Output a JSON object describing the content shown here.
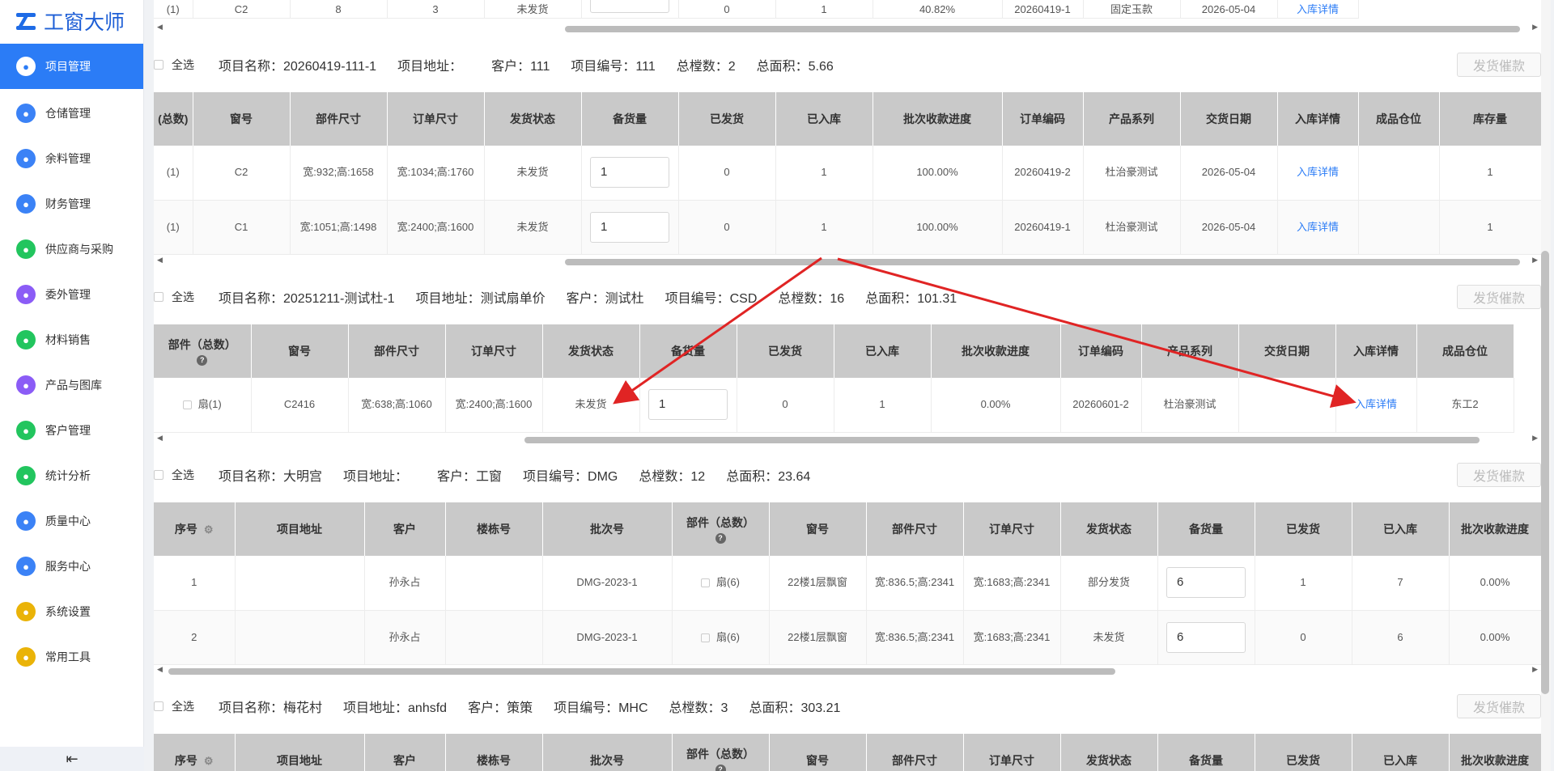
{
  "app": {
    "title": "工窗大师"
  },
  "sidebar": {
    "items": [
      {
        "label": "项目管理",
        "icon": "puzzle-icon",
        "color": "#22c55e",
        "active": true
      },
      {
        "label": "仓储管理",
        "icon": "layers-icon",
        "color": "#3b82f6"
      },
      {
        "label": "余料管理",
        "icon": "recycle-icon",
        "color": "#3b82f6"
      },
      {
        "label": "财务管理",
        "icon": "finance-icon",
        "color": "#3b82f6"
      },
      {
        "label": "供应商与采购",
        "icon": "supplier-icon",
        "color": "#22c55e"
      },
      {
        "label": "委外管理",
        "icon": "outsource-icon",
        "color": "#8b5cf6"
      },
      {
        "label": "材料销售",
        "icon": "material-sales-icon",
        "color": "#22c55e"
      },
      {
        "label": "产品与图库",
        "icon": "product-gallery-icon",
        "color": "#8b5cf6"
      },
      {
        "label": "客户管理",
        "icon": "customer-icon",
        "color": "#22c55e"
      },
      {
        "label": "统计分析",
        "icon": "stats-icon",
        "color": "#22c55e"
      },
      {
        "label": "质量中心",
        "icon": "flask-icon",
        "color": "#3b82f6"
      },
      {
        "label": "服务中心",
        "icon": "phone-icon",
        "color": "#3b82f6"
      },
      {
        "label": "系统设置",
        "icon": "settings-icon",
        "color": "#eab308"
      },
      {
        "label": "常用工具",
        "icon": "tools-icon",
        "color": "#eab308"
      }
    ],
    "collapse_icon": "collapse-menu-icon"
  },
  "common": {
    "select_all": "全选",
    "ship_button": "发货催款"
  },
  "projects": [
    {
      "name": "项目名称：20260419-111-1",
      "address": "项目地址：",
      "customer": "客户：111",
      "code": "项目编号：111",
      "floors": "总樘数：2",
      "area": "总面积：5.66",
      "headers": [
        "(总数)",
        "窗号",
        "部件尺寸",
        "订单尺寸",
        "发货状态",
        "备货量",
        "已发货",
        "已入库",
        "批次收款进度",
        "订单编码",
        "产品系列",
        "交货日期",
        "入库详情",
        "成品仓位",
        "库存量"
      ],
      "rows": [
        [
          "(1)",
          "C2",
          "宽:932;高:1658",
          "宽:1034;高:1760",
          "未发货",
          "1",
          "0",
          "1",
          "100.00%",
          "20260419-2",
          "杜治豪测试",
          "2026-05-04",
          "入库详情",
          "",
          "1"
        ],
        [
          "(1)",
          "C1",
          "宽:1051;高:1498",
          "宽:2400;高:1600",
          "未发货",
          "1",
          "0",
          "1",
          "100.00%",
          "20260419-1",
          "杜治豪测试",
          "2026-05-04",
          "入库详情",
          "",
          "1"
        ]
      ]
    },
    {
      "name": "项目名称：20251211-测试杜-1",
      "address": "项目地址：测试扇单价",
      "customer": "客户：测试杜",
      "code": "项目编号：CSD",
      "floors": "总樘数：16",
      "area": "总面积：101.31",
      "headers": [
        "部件（总数）",
        "窗号",
        "部件尺寸",
        "订单尺寸",
        "发货状态",
        "备货量",
        "已发货",
        "已入库",
        "批次收款进度",
        "订单编码",
        "产品系列",
        "交货日期",
        "入库详情",
        "成品仓位"
      ],
      "rows": [
        [
          "扇(1)",
          "C2416",
          "宽:638;高:1060",
          "宽:2400;高:1600",
          "未发货",
          "1",
          "0",
          "1",
          "0.00%",
          "20260601-2",
          "杜治豪测试",
          "",
          "入库详情",
          "东工2"
        ]
      ]
    },
    {
      "name": "项目名称：大明宫",
      "address": "项目地址：",
      "customer": "客户：工窗",
      "code": "项目编号：DMG",
      "floors": "总樘数：12",
      "area": "总面积：23.64",
      "headers": [
        "序号",
        "项目地址",
        "客户",
        "楼栋号",
        "批次号",
        "部件（总数）",
        "窗号",
        "部件尺寸",
        "订单尺寸",
        "发货状态",
        "备货量",
        "已发货",
        "已入库",
        "批次收款进度"
      ],
      "rows": [
        [
          "1",
          "",
          "孙永占",
          "",
          "DMG-2023-1",
          "扇(6)",
          "22楼1层飘窗",
          "宽:836.5;高:2341",
          "宽:1683;高:2341",
          "部分发货",
          "6",
          "1",
          "7",
          "0.00%"
        ],
        [
          "2",
          "",
          "孙永占",
          "",
          "DMG-2023-1",
          "扇(6)",
          "22楼1层飘窗",
          "宽:836.5;高:2341",
          "宽:1683;高:2341",
          "未发货",
          "6",
          "0",
          "6",
          "0.00%"
        ]
      ]
    },
    {
      "name": "项目名称：梅花村",
      "address": "项目地址：anhsfd",
      "customer": "客户：策策",
      "code": "项目编号：MHC",
      "floors": "总樘数：3",
      "area": "总面积：303.21",
      "headers": [
        "序号",
        "项目地址",
        "客户",
        "楼栋号",
        "批次号",
        "部件（总数）",
        "窗号",
        "部件尺寸",
        "订单尺寸",
        "发货状态",
        "备货量",
        "已发货",
        "已入库",
        "批次收款进度"
      ]
    }
  ],
  "top_partial_row": [
    "(1)",
    "C2",
    "8",
    "3",
    "未发货",
    "",
    "0",
    "1",
    "40.82%",
    "20260419-1",
    "固定玉款",
    "2026-05-04",
    "入库详情"
  ],
  "annotation": {
    "arrow_color": "#e02424"
  }
}
